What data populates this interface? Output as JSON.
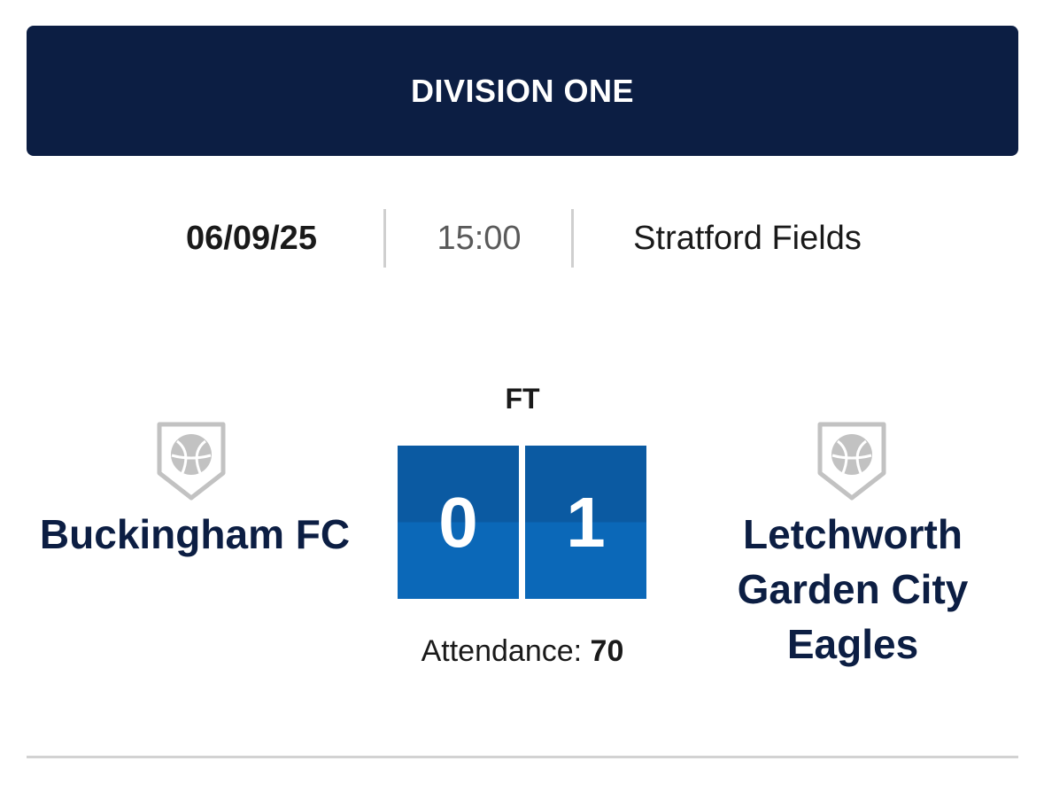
{
  "division": {
    "title": "DIVISION ONE"
  },
  "match": {
    "date": "06/09/25",
    "time": "15:00",
    "venue": "Stratford Fields",
    "status": "FT",
    "attendance_label": "Attendance:",
    "attendance_value": "70"
  },
  "home_team": {
    "name": "Buckingham FC",
    "score": "0",
    "crest_icon": "club-crest-placeholder-icon"
  },
  "away_team": {
    "name": "Letchworth Garden City Eagles",
    "score": "1",
    "crest_icon": "club-crest-placeholder-icon"
  },
  "colors": {
    "banner": "#0c1e43",
    "team_name": "#0c1e43",
    "score_top": "#0b5aa2",
    "score_bottom": "#0b68b8",
    "crest_grey": "#c2c2c2"
  }
}
